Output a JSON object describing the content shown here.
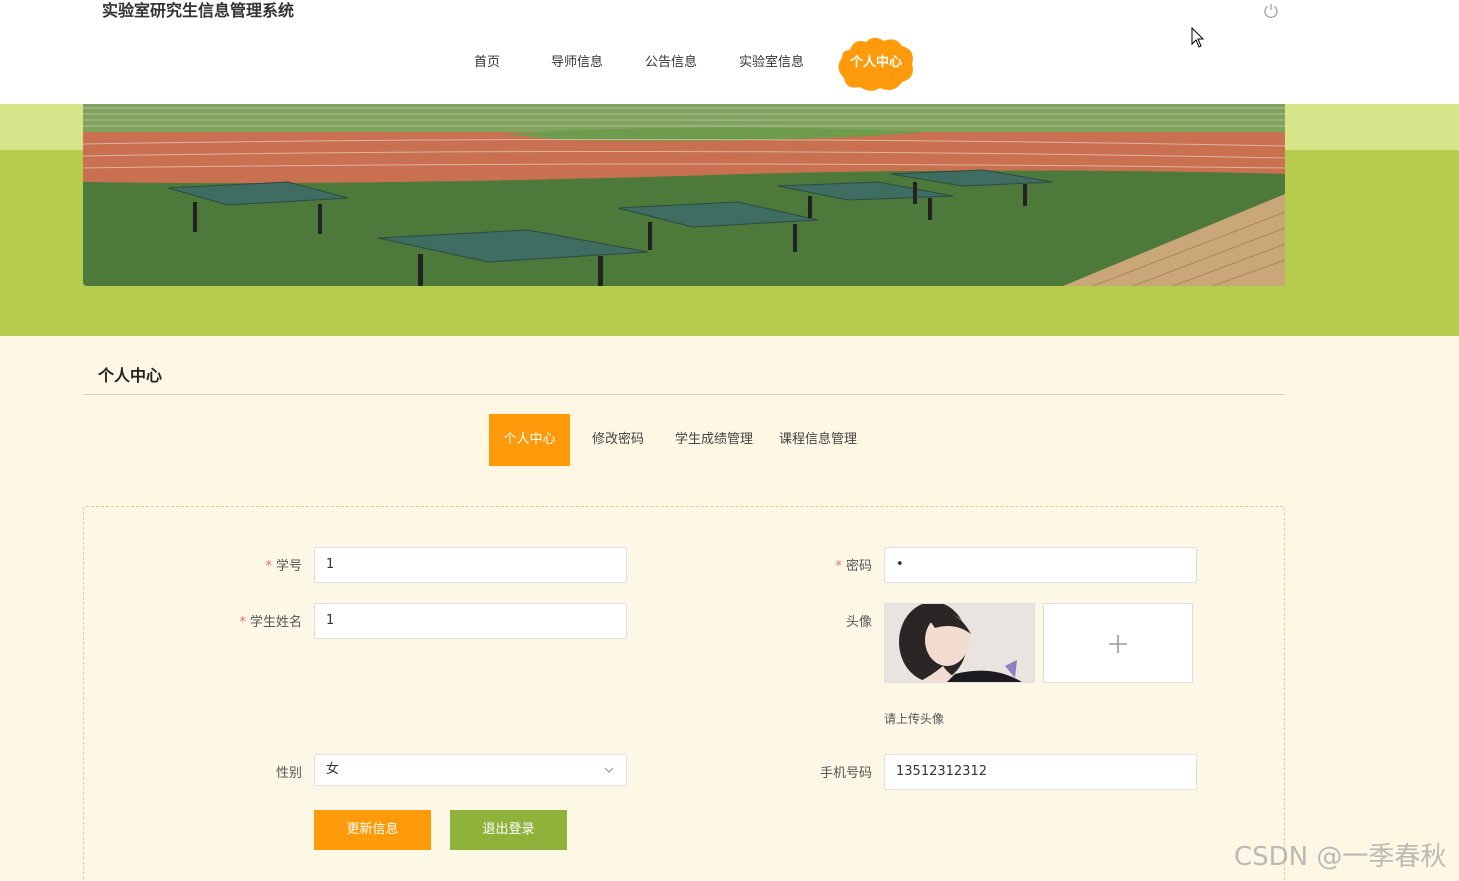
{
  "header": {
    "app_title": "实验室研究生信息管理系统",
    "nav": [
      {
        "label": "首页"
      },
      {
        "label": "导师信息"
      },
      {
        "label": "公告信息"
      },
      {
        "label": "实验室信息"
      },
      {
        "label": "个人中心"
      }
    ],
    "active_nav": "个人中心"
  },
  "section": {
    "title": "个人中心"
  },
  "tabs": [
    {
      "label": "个人中心"
    },
    {
      "label": "修改密码"
    },
    {
      "label": "学生成绩管理"
    },
    {
      "label": "课程信息管理"
    }
  ],
  "form": {
    "student_id": {
      "label": "学号",
      "required_mark": "*",
      "value": "1"
    },
    "password": {
      "label": "密码",
      "required_mark": "*",
      "value": "•"
    },
    "student_name": {
      "label": "学生姓名",
      "required_mark": "*",
      "value": "1"
    },
    "avatar": {
      "label": "头像",
      "hint": "请上传头像"
    },
    "gender": {
      "label": "性别",
      "value": "女"
    },
    "phone": {
      "label": "手机号码",
      "value": "13512312312"
    }
  },
  "buttons": {
    "update": "更新信息",
    "logout": "退出登录"
  },
  "watermark": "CSDN @一季春秋",
  "colors": {
    "accent_orange": "#ff9a0a",
    "accent_green": "#b5cc4c",
    "button_green": "#8fb23a",
    "page_bg": "#fdf7e4"
  }
}
